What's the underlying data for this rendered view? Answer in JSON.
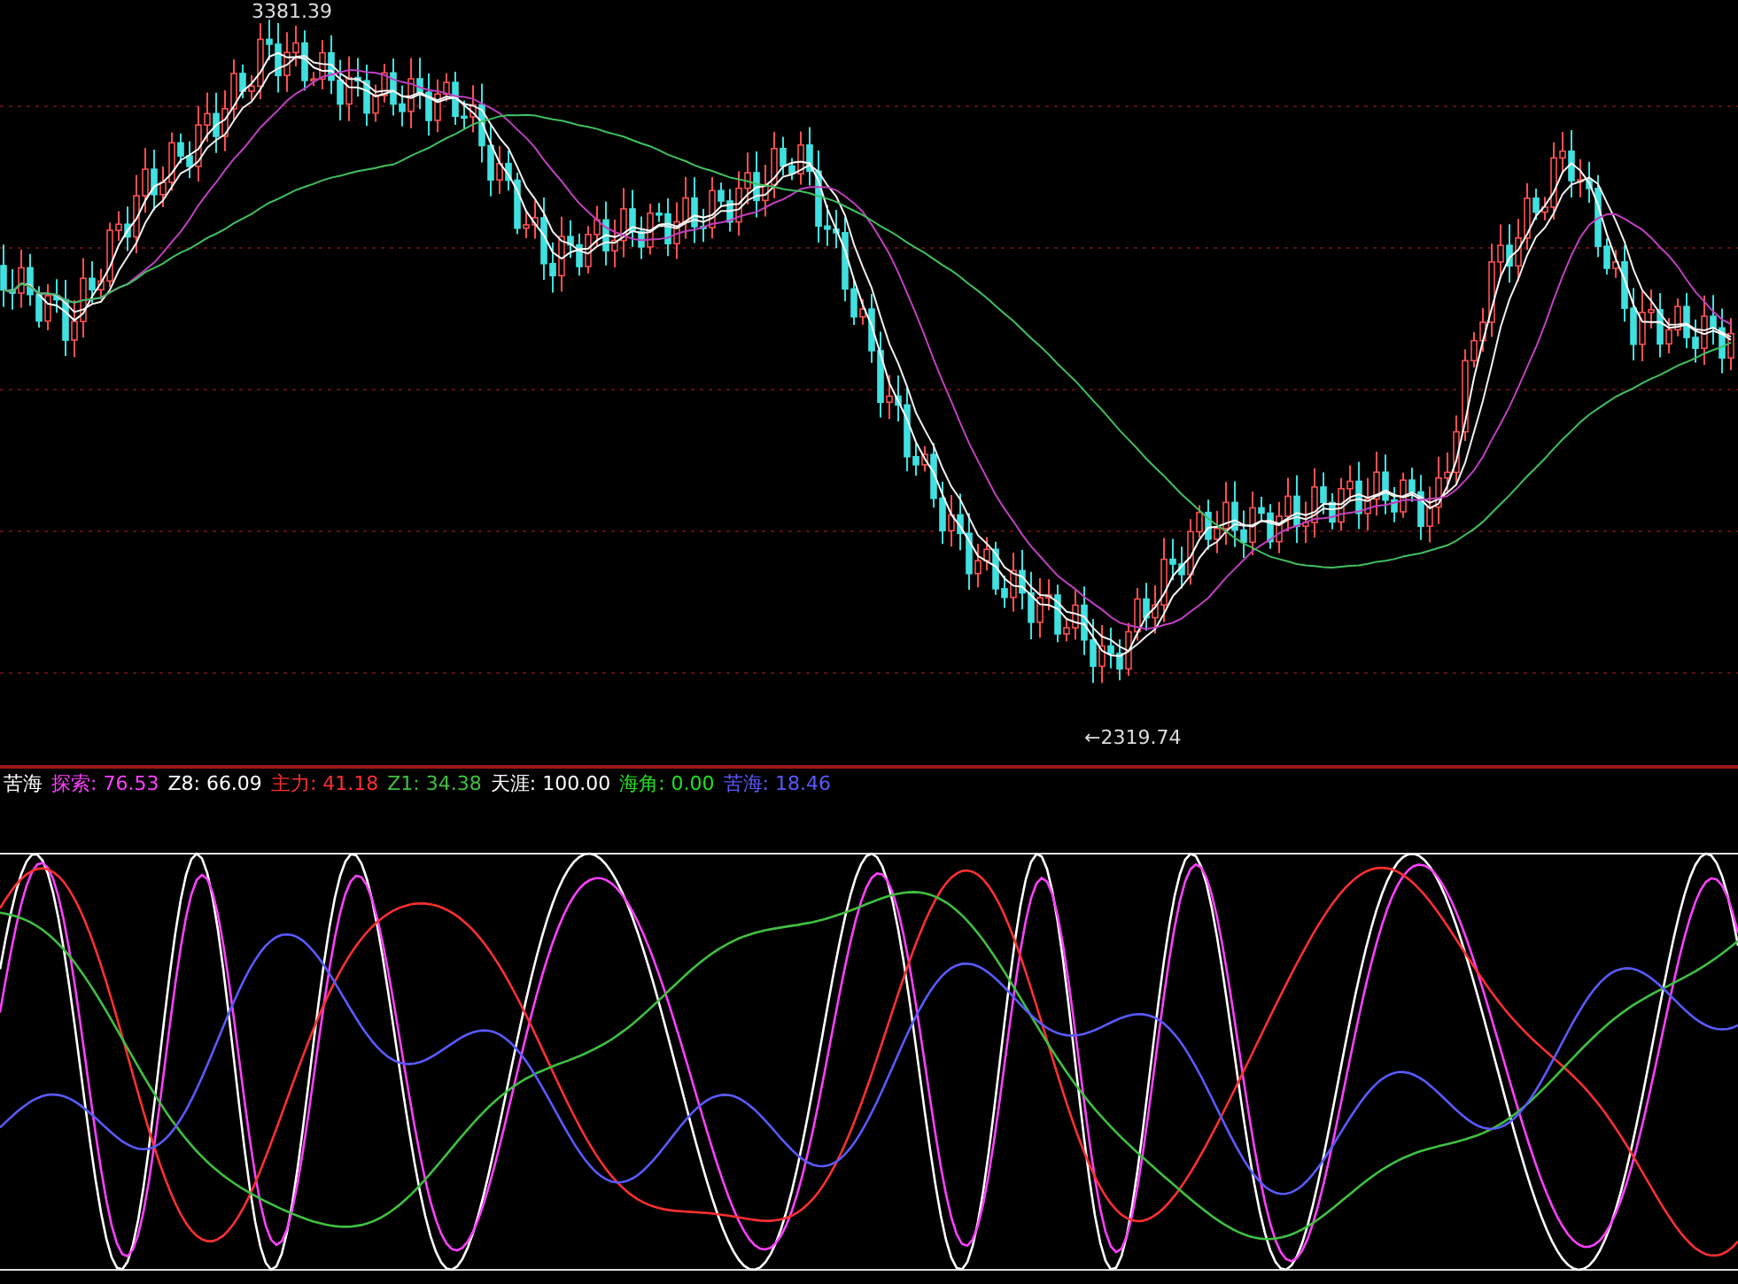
{
  "price_panel": {
    "high_label": "3381.39",
    "low_label": "←2319.74"
  },
  "indicator_panel": {
    "name": "苦海",
    "readings": [
      {
        "text": "探索: 76.53",
        "color": "#ff40ff"
      },
      {
        "text": "Z8: 66.09",
        "color": "#ffffff"
      },
      {
        "text": "主力: 41.18",
        "color": "#ff3030"
      },
      {
        "text": "Z1: 34.38",
        "color": "#40c040"
      },
      {
        "text": "天涯: 100.00",
        "color": "#ffffff"
      },
      {
        "text": "海角: 0.00",
        "color": "#20e020"
      },
      {
        "text": "苦海: 18.46",
        "color": "#5a5aff"
      }
    ]
  }
}
